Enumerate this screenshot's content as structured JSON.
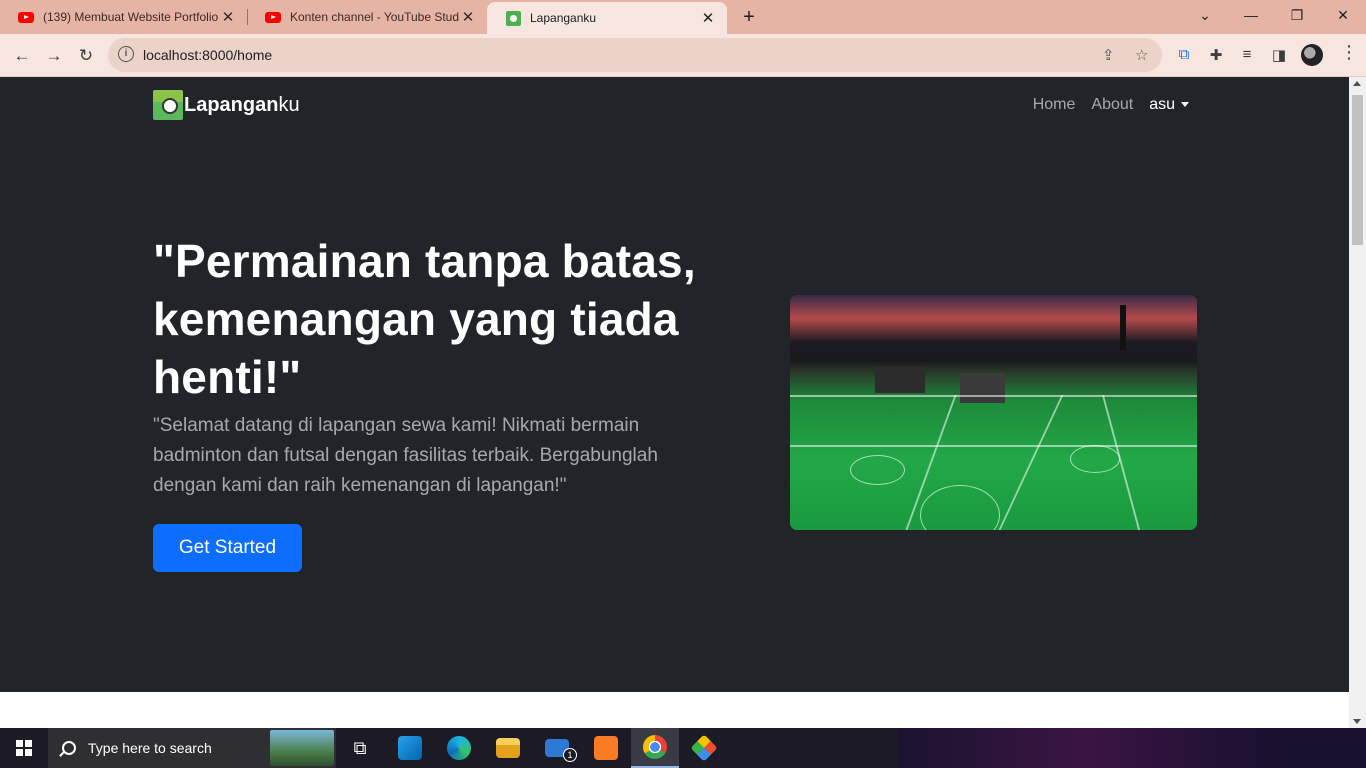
{
  "browser": {
    "tabs": [
      {
        "title": "(139) Membuat Website Portfolio",
        "icon": "youtube-icon"
      },
      {
        "title": "Konten channel - YouTube Studio",
        "icon": "youtube-icon"
      },
      {
        "title": "Lapanganku",
        "icon": "site-favicon-icon",
        "active": true
      }
    ],
    "url": "localhost:8000/home"
  },
  "navbar": {
    "brand_bold": "Lapangan",
    "brand_rest": "ku",
    "links": [
      "Home",
      "About"
    ],
    "user": "asu"
  },
  "hero": {
    "headline": "\"Permainan tanpa batas, kemenangan yang tiada henti!\"",
    "lead": "\"Selamat datang di lapangan sewa kami! Nikmati bermain badminton dan futsal dengan fasilitas terbaik. Bergabunglah dengan kami dan raih kemenangan di lapangan!\"",
    "button": "Get Started",
    "image_alt": "rooftop-futsal-courts-at-dusk"
  },
  "taskbar": {
    "search_placeholder": "Type here to search",
    "mail_badge": "1"
  },
  "colors": {
    "hero_bg": "#212529",
    "primary_button": "#0d6efd",
    "tabstrip": "#e6b4a4"
  }
}
